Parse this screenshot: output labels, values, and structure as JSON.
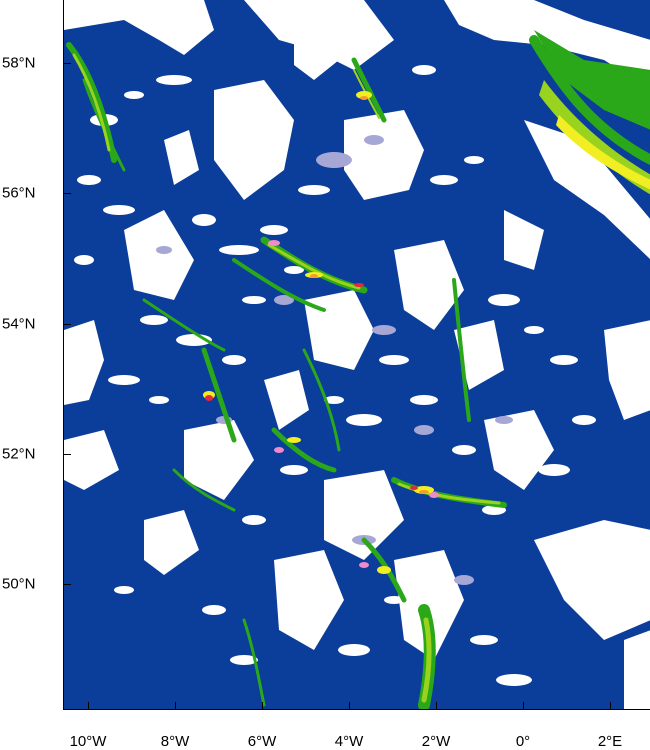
{
  "map": {
    "lat_labels": [
      "58°N",
      "56°N",
      "54°N",
      "52°N",
      "50°N"
    ],
    "lon_labels": [
      "10°W",
      "8°W",
      "6°W",
      "4°W",
      "2°W",
      "0°",
      "2°E"
    ],
    "colors": {
      "ocean_deep": "#0b3d9a",
      "white": "#ffffff",
      "lavender": "#a7a7d6",
      "green": "#2aa819",
      "light_green": "#9ad31d",
      "yellow": "#f2ee24",
      "orange": "#f49d2a",
      "red": "#e8283d",
      "pink": "#f08ac8"
    }
  }
}
